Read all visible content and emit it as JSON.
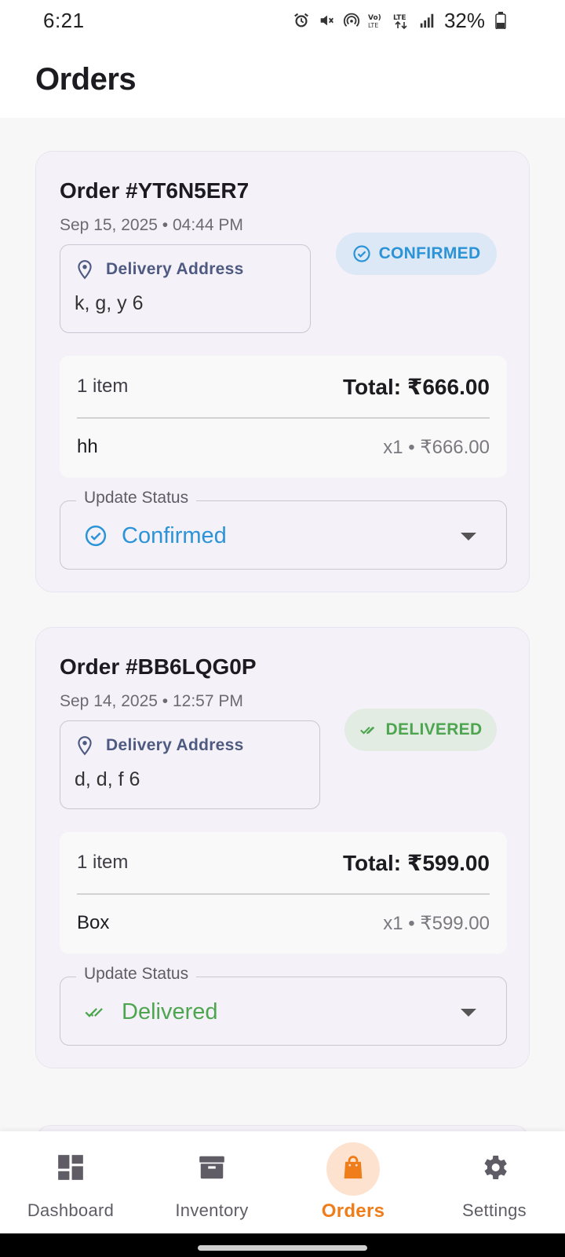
{
  "status_bar": {
    "time": "6:21",
    "battery": "32%",
    "icons": [
      "alarm-icon",
      "mute-icon",
      "hotspot-icon",
      "volte-icon",
      "lte-icon",
      "signal-icon",
      "battery-icon"
    ]
  },
  "app_bar": {
    "title": "Orders"
  },
  "orders": [
    {
      "id": "Order #YT6N5ER7",
      "date": "Sep 15, 2025 • 04:44 PM",
      "address_label": "Delivery Address",
      "address": "k, g, y 6",
      "status_chip": "CONFIRMED",
      "item_count": "1 item",
      "total": "Total: ₹666.00",
      "items": [
        {
          "name": "hh",
          "meta": "x1 • ₹666.00"
        }
      ],
      "update_label": "Update Status",
      "update_value": "Confirmed"
    },
    {
      "id": "Order #BB6LQG0P",
      "date": "Sep 14, 2025 • 12:57 PM",
      "address_label": "Delivery Address",
      "address": "d, d, f 6",
      "status_chip": "DELIVERED",
      "item_count": "1 item",
      "total": "Total: ₹599.00",
      "items": [
        {
          "name": "Box",
          "meta": "x1 • ₹599.00"
        }
      ],
      "update_label": "Update Status",
      "update_value": "Delivered"
    }
  ],
  "nav": [
    {
      "label": "Dashboard",
      "icon": "dashboard-icon"
    },
    {
      "label": "Inventory",
      "icon": "inventory-icon"
    },
    {
      "label": "Orders",
      "icon": "shopping-bag-icon",
      "active": true
    },
    {
      "label": "Settings",
      "icon": "gear-icon"
    }
  ],
  "colors": {
    "confirmed": "#2b93d6",
    "delivered": "#4ea54f",
    "accent": "#ef7d1a",
    "card_bg": "#f4f2f8"
  }
}
